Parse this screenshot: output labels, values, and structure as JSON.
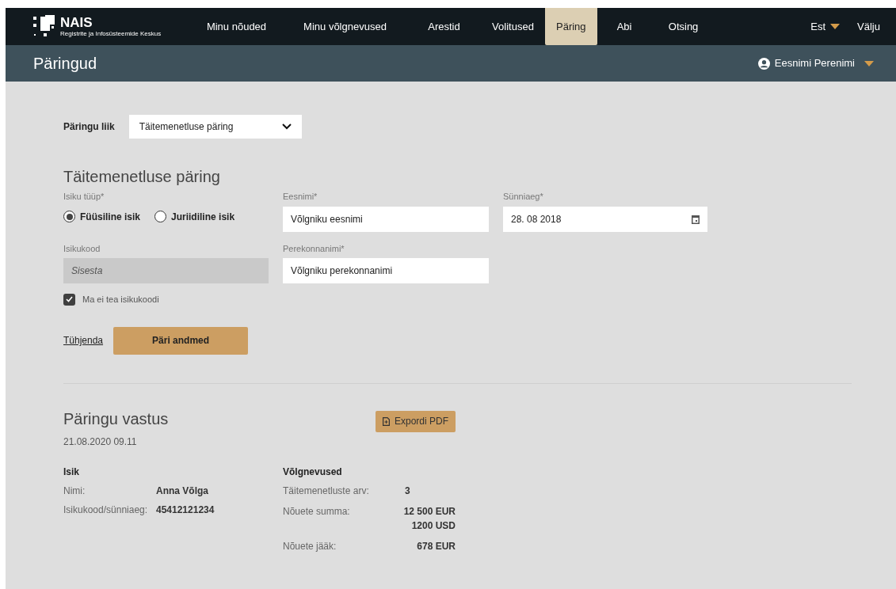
{
  "header": {
    "logo": {
      "name": "NAIS",
      "subtitle": "Registrite ja Infosüsteemide Keskus"
    },
    "nav": [
      {
        "label": "Minu nõuded",
        "selected": false
      },
      {
        "label": "Minu võlgnevused",
        "selected": false
      },
      {
        "label": "Arestid",
        "selected": false
      },
      {
        "label": "Volitused",
        "selected": false
      },
      {
        "label": "Päring",
        "selected": true
      },
      {
        "label": "Abi",
        "selected": false
      },
      {
        "label": "Otsing",
        "selected": false
      }
    ],
    "language": "Est",
    "logout": "Välju"
  },
  "page_title": "Päringud",
  "user_menu": "Eesnimi Perenimi",
  "query_type": {
    "label": "Päringu liik",
    "value": "Täitemenetluse päring"
  },
  "form": {
    "title": "Täitemenetluse päring",
    "person_type": {
      "label": "Isiku tüüp*",
      "options": [
        {
          "label": "Füüsiline isik",
          "selected": true
        },
        {
          "label": "Juriidiline isik",
          "selected": false
        }
      ]
    },
    "first_name": {
      "label": "Eesnimi*",
      "value": "Võlgniku eesnimi"
    },
    "birth_date": {
      "label": "Sünniaeg*",
      "value": "28. 08 2018"
    },
    "personal_code": {
      "label": "Isikukood",
      "placeholder": "Sisesta",
      "disabled": true
    },
    "last_name": {
      "label": "Perekonnanimi*",
      "value": "Võlgniku perekonnanimi"
    },
    "unknown_code": {
      "label": "Ma ei tea isikukoodi",
      "checked": true
    },
    "clear_link": "Tühjenda",
    "submit_button": "Päri andmed"
  },
  "result": {
    "title": "Päringu vastus",
    "timestamp": "21.08.2020 09.11",
    "export_button": "Expordi PDF",
    "person": {
      "heading": "Isik",
      "rows": [
        {
          "label": "Nimi:",
          "value": "Anna Võlga"
        },
        {
          "label": "Isikukood/sünniaeg:",
          "value": "45412121234"
        }
      ]
    },
    "debts": {
      "heading": "Võlgnevused",
      "rows": [
        {
          "label": "Täitemenetluste arv:",
          "values": [
            "3"
          ]
        },
        {
          "label": "Nõuete summa:",
          "values": [
            "12 500 EUR",
            "1200 USD"
          ]
        },
        {
          "label": "Nõuete jääk:",
          "values": [
            "678 EUR"
          ]
        }
      ]
    }
  }
}
